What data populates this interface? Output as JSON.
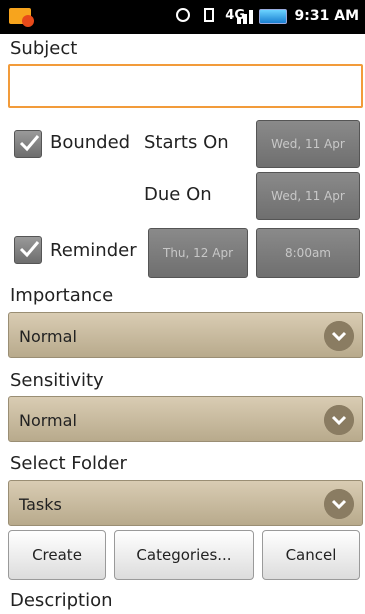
{
  "status_bar": {
    "time": "9:31 AM",
    "network_label": "4G"
  },
  "form": {
    "subject_label": "Subject",
    "subject_value": "",
    "bounded": {
      "label": "Bounded",
      "checked": true
    },
    "starts_on": {
      "label": "Starts On",
      "value": "Wed, 11 Apr"
    },
    "due_on": {
      "label": "Due On",
      "value": "Wed, 11 Apr"
    },
    "reminder": {
      "label": "Reminder",
      "checked": true,
      "date": "Thu, 12 Apr",
      "time": "8:00am"
    },
    "importance": {
      "label": "Importance",
      "value": "Normal"
    },
    "sensitivity": {
      "label": "Sensitivity",
      "value": "Normal"
    },
    "folder": {
      "label": "Select Folder",
      "value": "Tasks"
    },
    "description_label": "Description"
  },
  "actions": {
    "create": "Create",
    "categories": "Categories...",
    "cancel": "Cancel"
  },
  "colors": {
    "status_bar": "#000000",
    "input_focus": "#f29b3a",
    "dropdown_bg": "#cbbd9f",
    "disabled_button": "#7d7d7d"
  },
  "icons": {
    "app": "notification-icon",
    "checkbox": "checkmark-icon",
    "dropdown": "chevron-down-icon"
  }
}
